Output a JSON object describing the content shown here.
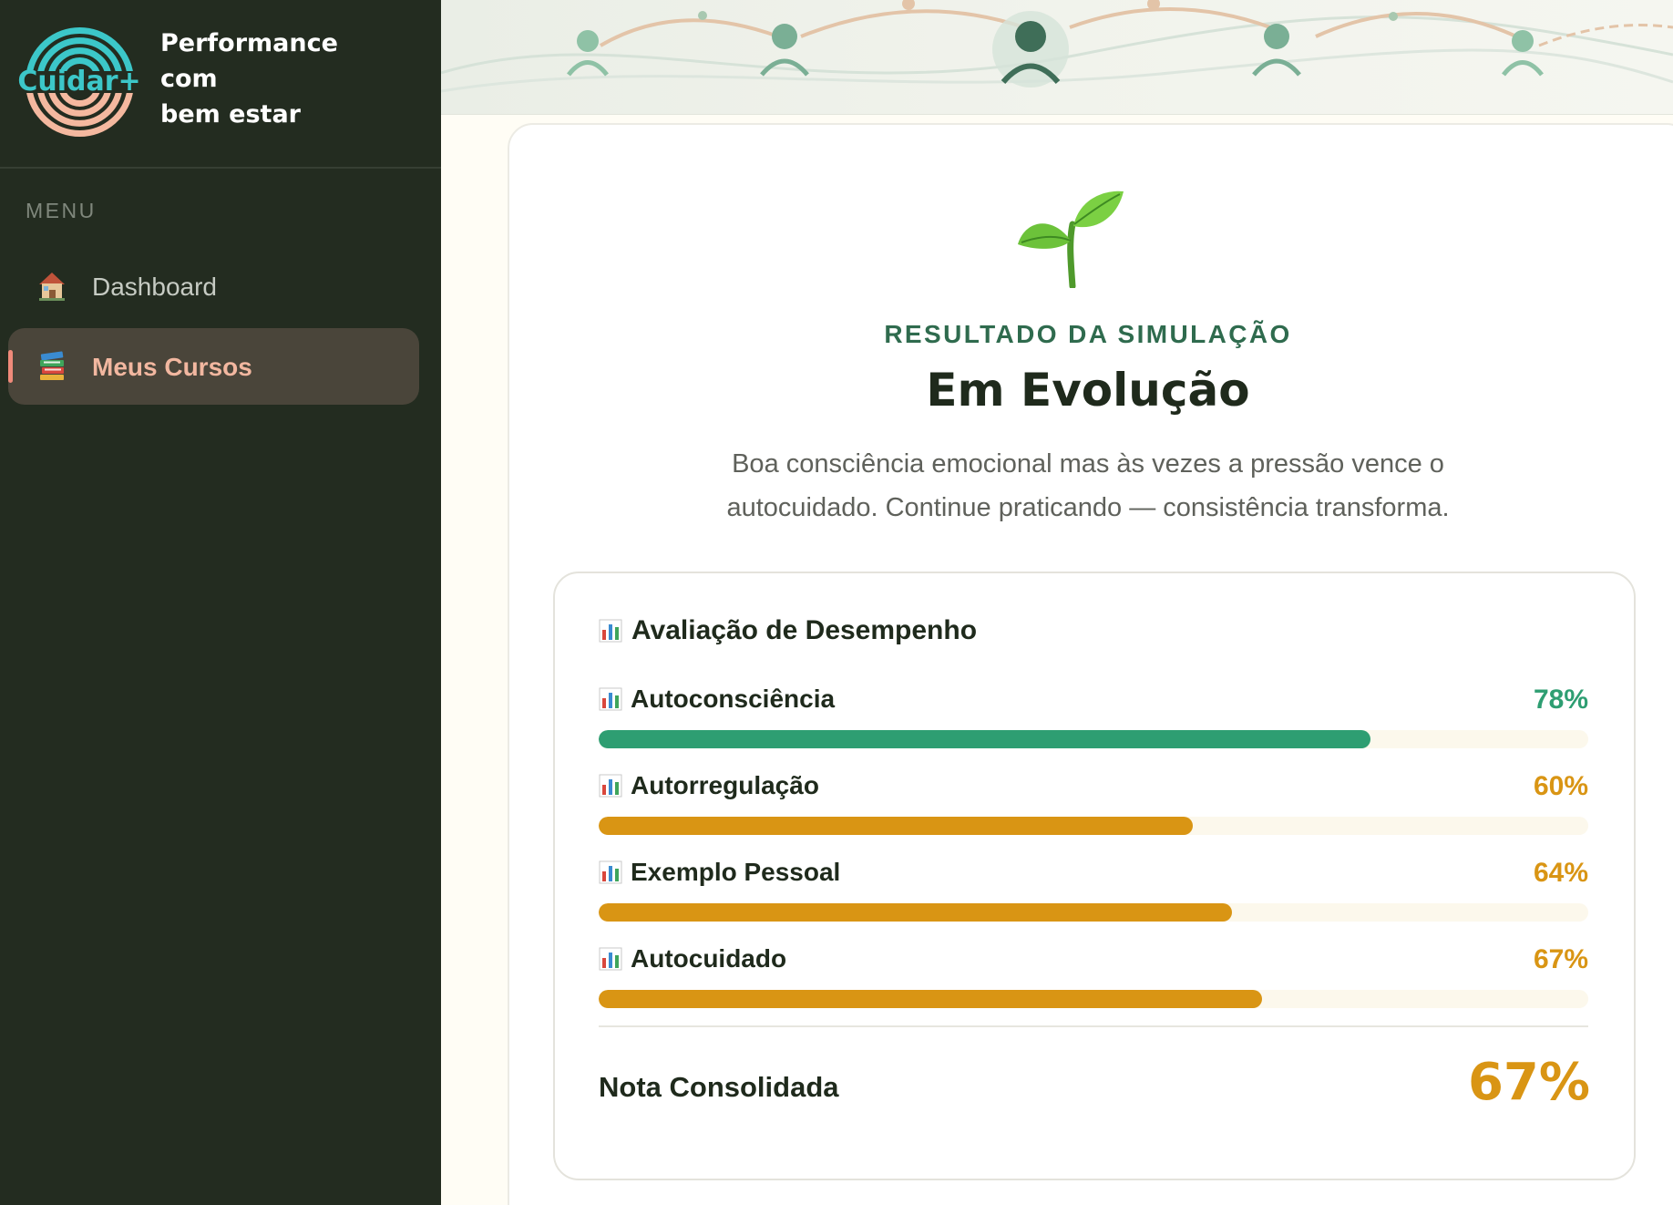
{
  "brand": {
    "logo_text": "Cuidar+",
    "tagline_line1": "Performance",
    "tagline_line2": "com",
    "tagline_line3": "bem estar"
  },
  "menu": {
    "heading": "MENU",
    "items": [
      {
        "label": "Dashboard",
        "icon": "house-icon",
        "active": false
      },
      {
        "label": "Meus Cursos",
        "icon": "books-icon",
        "active": true
      }
    ]
  },
  "result": {
    "kicker": "RESULTADO DA SIMULAÇÃO",
    "title": "Em Evolução",
    "description": "Boa consciência emocional mas às vezes a pressão vence o autocuidado. Continue praticando — consistência transforma.",
    "icon": "sprout-icon"
  },
  "performance": {
    "title": "Avaliação de Desempenho",
    "metrics": [
      {
        "label": "Autoconsciência",
        "value": "78%",
        "fraction": 0.78,
        "color": "#2e9e72"
      },
      {
        "label": "Autorregulação",
        "value": "60%",
        "fraction": 0.6,
        "color": "#d99514"
      },
      {
        "label": "Exemplo Pessoal",
        "value": "64%",
        "fraction": 0.64,
        "color": "#d99514"
      },
      {
        "label": "Autocuidado",
        "value": "67%",
        "fraction": 0.67,
        "color": "#d99514"
      }
    ],
    "total_label": "Nota Consolidada",
    "total_value": "67%",
    "total_color": "#d99514"
  },
  "colors": {
    "sidebar_bg": "#232c20",
    "accent_green": "#2e9e72",
    "accent_amber": "#d99514",
    "active_text": "#f2b7a0"
  }
}
